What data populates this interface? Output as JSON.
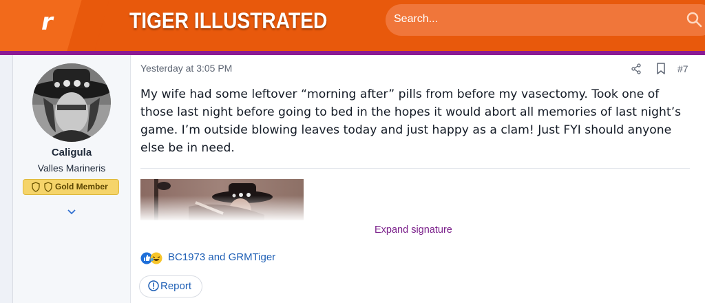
{
  "header": {
    "logo_letter": "r",
    "site_title": "TIGER ILLUSTRATED",
    "search_placeholder": "Search..."
  },
  "user": {
    "name": "Caligula",
    "title": "Valles Marineris",
    "badge": "Gold Member"
  },
  "post": {
    "timestamp": "Yesterday at 3:05 PM",
    "number": "#7",
    "message": "My wife had some leftover “morning after” pills from before my vasectomy. Took one of those last night before going to bed in the hopes it would abort all memories of last night’s game. I’m outside blowing leaves today and just happy as a clam! Just FYI should anyone else be in need.",
    "expand_signature": "Expand signature",
    "reaction_users": "BC1973 and GRMTiger",
    "report_label": "Report"
  },
  "colors": {
    "brand": "#e8590c",
    "accent_stripe": "#8b1a94",
    "link": "#1e5fb5",
    "badge": "#f5d46a"
  },
  "icons": [
    "search-icon",
    "share-icon",
    "bookmark-icon",
    "like-icon",
    "laugh-icon",
    "report-icon",
    "chevron-down-icon"
  ]
}
